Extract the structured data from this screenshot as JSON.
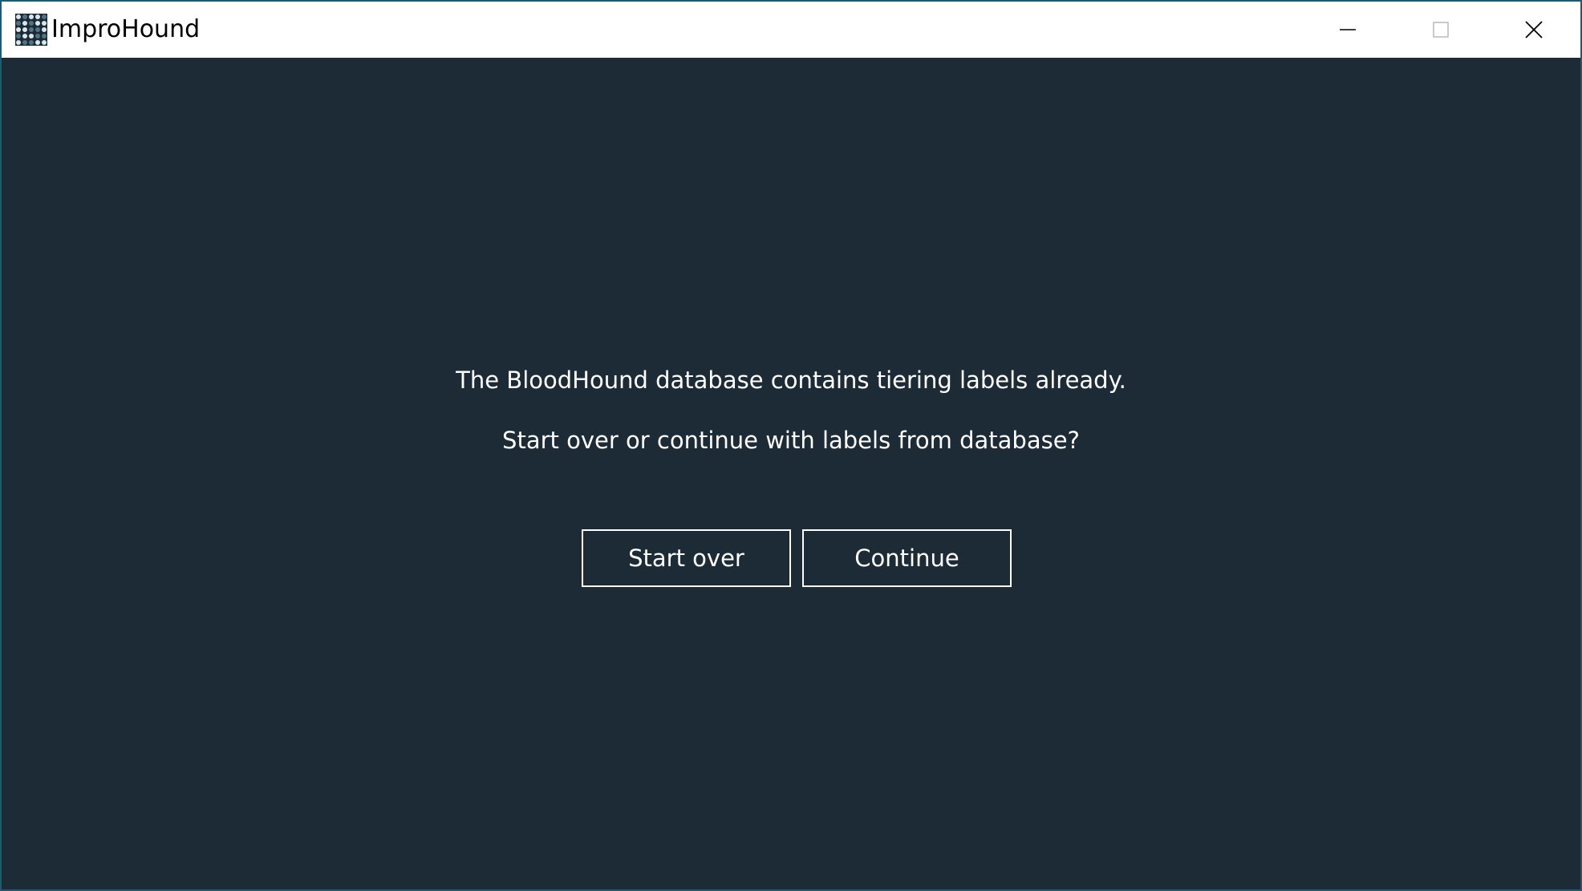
{
  "window": {
    "title": "ImproHound",
    "controls": {
      "minimize_icon": "minimize-icon",
      "maximize_icon": "maximize-icon",
      "close_icon": "close-icon"
    }
  },
  "dialog": {
    "message_line1": "The BloodHound database contains tiering labels already.",
    "message_line2": "Start over or continue with labels from database?",
    "start_over_label": "Start over",
    "continue_label": "Continue"
  },
  "colors": {
    "background": "#1c2b36",
    "titlebar": "#ffffff",
    "text": "#ffffff",
    "border": "#1f5a6e"
  }
}
